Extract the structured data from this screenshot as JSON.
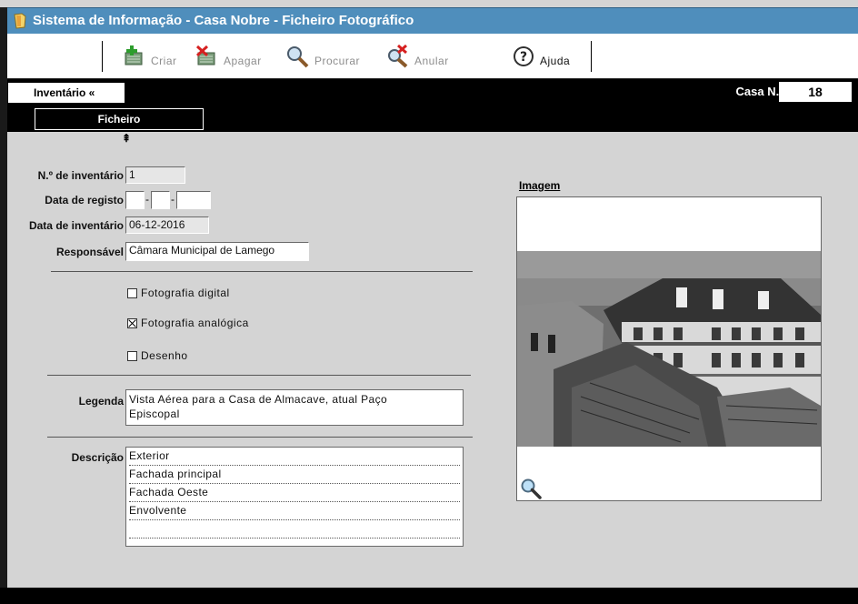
{
  "window": {
    "title": "Sistema de Informação - Casa Nobre - Ficheiro Fotográfico"
  },
  "toolbar": {
    "criar": "Criar",
    "apagar": "Apagar",
    "procurar": "Procurar",
    "anular": "Anular",
    "ajuda": "Ajuda"
  },
  "nav": {
    "inventario_tab": "Inventário «",
    "casa_label": "Casa N.º",
    "casa_value": "18"
  },
  "tabs": {
    "ficheiro": "Ficheiro",
    "arrow": "⇞"
  },
  "form": {
    "n_inventario_label": "N.º de inventário",
    "n_inventario_value": "1",
    "data_registo_label": "Data de registo",
    "data_registo_sep1": "-",
    "data_registo_sep2": "-",
    "data_inventario_label": "Data de inventário",
    "data_inventario_value": "06-12-2016",
    "responsavel_label": "Responsável",
    "responsavel_value": "Câmara Municipal de Lamego",
    "fotografia_digital": "Fotografia digital",
    "fotografia_digital_checked": false,
    "fotografia_analogica": "Fotografia analógica",
    "fotografia_analogica_checked": true,
    "desenho": "Desenho",
    "desenho_checked": false,
    "legenda_label": "Legenda",
    "legenda_line1": "Vista Aérea para a Casa de Almacave, atual Paço",
    "legenda_line2": "Episcopal",
    "descricao_label": "Descrição",
    "descricao_items": [
      "Exterior",
      "Fachada principal",
      "Fachada Oeste",
      "Envolvente",
      ""
    ]
  },
  "image": {
    "label": "Imagem",
    "zoom_icon": "magnifier-icon"
  },
  "colors": {
    "title_bar": "#4f8ebc",
    "background": "#d4d4d4"
  }
}
